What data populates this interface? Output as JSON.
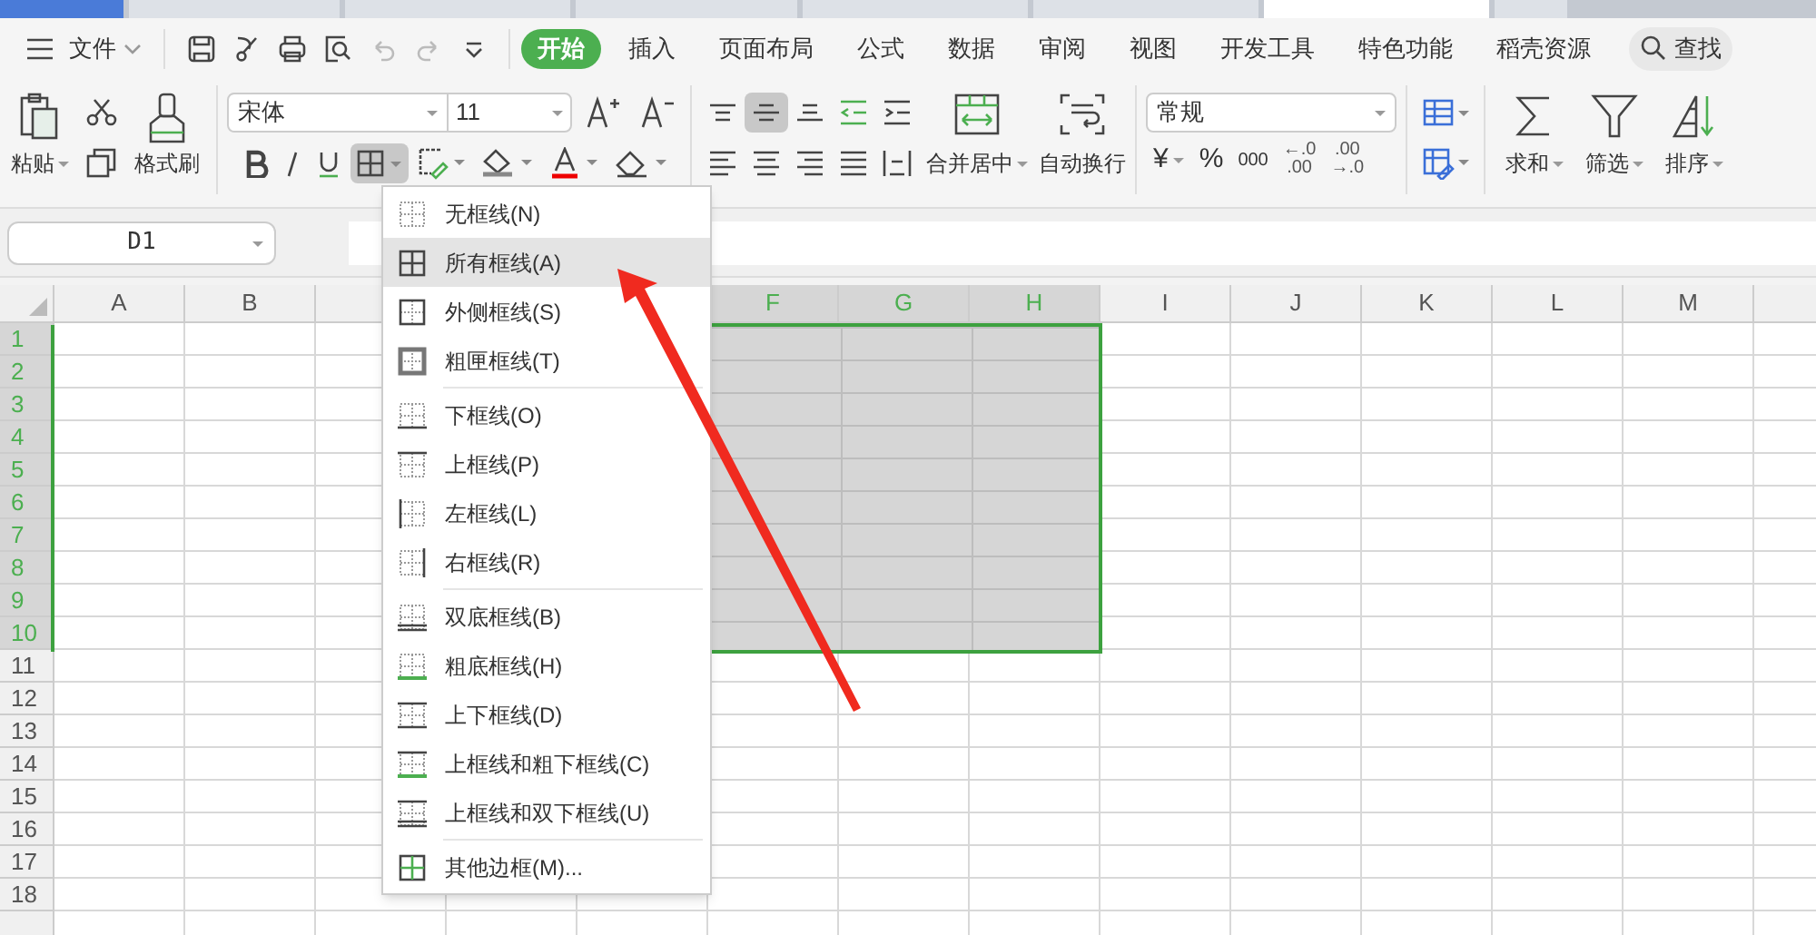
{
  "doc_tabs": [
    {
      "kind": "home",
      "selected": false
    },
    {
      "kind": "doc",
      "selected": false
    },
    {
      "kind": "doc",
      "selected": false
    },
    {
      "kind": "doc",
      "selected": false
    },
    {
      "kind": "doc",
      "selected": false
    },
    {
      "kind": "doc",
      "selected": false
    },
    {
      "kind": "doc",
      "selected": true
    },
    {
      "kind": "doc",
      "selected": false
    }
  ],
  "menu_bar": {
    "file": "文件",
    "tabs": [
      {
        "label": "开始",
        "selected": true
      },
      {
        "label": "插入",
        "selected": false
      },
      {
        "label": "页面布局",
        "selected": false
      },
      {
        "label": "公式",
        "selected": false
      },
      {
        "label": "数据",
        "selected": false
      },
      {
        "label": "审阅",
        "selected": false
      },
      {
        "label": "视图",
        "selected": false
      },
      {
        "label": "开发工具",
        "selected": false
      },
      {
        "label": "特色功能",
        "selected": false
      },
      {
        "label": "稻壳资源",
        "selected": false
      }
    ],
    "search": "查找"
  },
  "ribbon": {
    "paste": "粘贴",
    "format_painter": "格式刷",
    "font_name": "宋体",
    "font_size": "11",
    "borders_pressed": true,
    "align_middle_pressed": true,
    "merge": "合并居中",
    "wrap": "自动换行",
    "number_format": "常规",
    "currency": "¥",
    "percent": "%",
    "thousands": "000",
    "increase_decimal": [
      "←.0",
      ".00"
    ],
    "decrease_decimal": [
      ".00",
      "→.0"
    ],
    "sum": "求和",
    "filter": "筛选",
    "sort": "排序"
  },
  "name_box": "D1",
  "sheet": {
    "columns": [
      {
        "label": "A",
        "selected": false
      },
      {
        "label": "B",
        "selected": false
      },
      {},
      {},
      {},
      {
        "label": "F",
        "selected": true
      },
      {
        "label": "G",
        "selected": true
      },
      {
        "label": "H",
        "selected": true
      },
      {
        "label": "I",
        "selected": false
      },
      {
        "label": "J",
        "selected": false
      },
      {
        "label": "K",
        "selected": false
      },
      {
        "label": "L",
        "selected": false
      },
      {
        "label": "M",
        "selected": false
      },
      {}
    ],
    "rows": [
      {
        "label": "1",
        "selected": true
      },
      {
        "label": "2",
        "selected": true
      },
      {
        "label": "3",
        "selected": true
      },
      {
        "label": "4",
        "selected": true
      },
      {
        "label": "5",
        "selected": true
      },
      {
        "label": "6",
        "selected": true
      },
      {
        "label": "7",
        "selected": true
      },
      {
        "label": "8",
        "selected": true
      },
      {
        "label": "9",
        "selected": true
      },
      {
        "label": "10",
        "selected": true
      },
      {
        "label": "11",
        "selected": false
      },
      {
        "label": "12",
        "selected": false
      },
      {
        "label": "13",
        "selected": false
      },
      {
        "label": "14",
        "selected": false
      },
      {
        "label": "15",
        "selected": false
      },
      {
        "label": "16",
        "selected": false
      },
      {
        "label": "17",
        "selected": false
      },
      {
        "label": "18",
        "selected": false
      }
    ]
  },
  "border_menu": {
    "groups": [
      [
        {
          "label": "无框线(N)",
          "kind": "none",
          "selected": false
        },
        {
          "label": "所有框线(A)",
          "kind": "all",
          "selected": true
        },
        {
          "label": "外侧框线(S)",
          "kind": "outside",
          "selected": false
        },
        {
          "label": "粗匣框线(T)",
          "kind": "thick",
          "selected": false
        }
      ],
      [
        {
          "label": "下框线(O)",
          "kind": "bottom",
          "selected": false
        },
        {
          "label": "上框线(P)",
          "kind": "top",
          "selected": false
        },
        {
          "label": "左框线(L)",
          "kind": "left",
          "selected": false
        },
        {
          "label": "右框线(R)",
          "kind": "right",
          "selected": false
        }
      ],
      [
        {
          "label": "双底框线(B)",
          "kind": "double-bottom",
          "selected": false
        },
        {
          "label": "粗底框线(H)",
          "kind": "thick-bottom",
          "selected": false
        },
        {
          "label": "上下框线(D)",
          "kind": "top-bottom",
          "selected": false
        },
        {
          "label": "上框线和粗下框线(C)",
          "kind": "top-thick-bottom",
          "selected": false
        },
        {
          "label": "上框线和双下框线(U)",
          "kind": "top-double-bottom",
          "selected": false
        }
      ],
      [
        {
          "label": "其他边框(M)...",
          "kind": "more",
          "selected": false
        }
      ]
    ]
  }
}
